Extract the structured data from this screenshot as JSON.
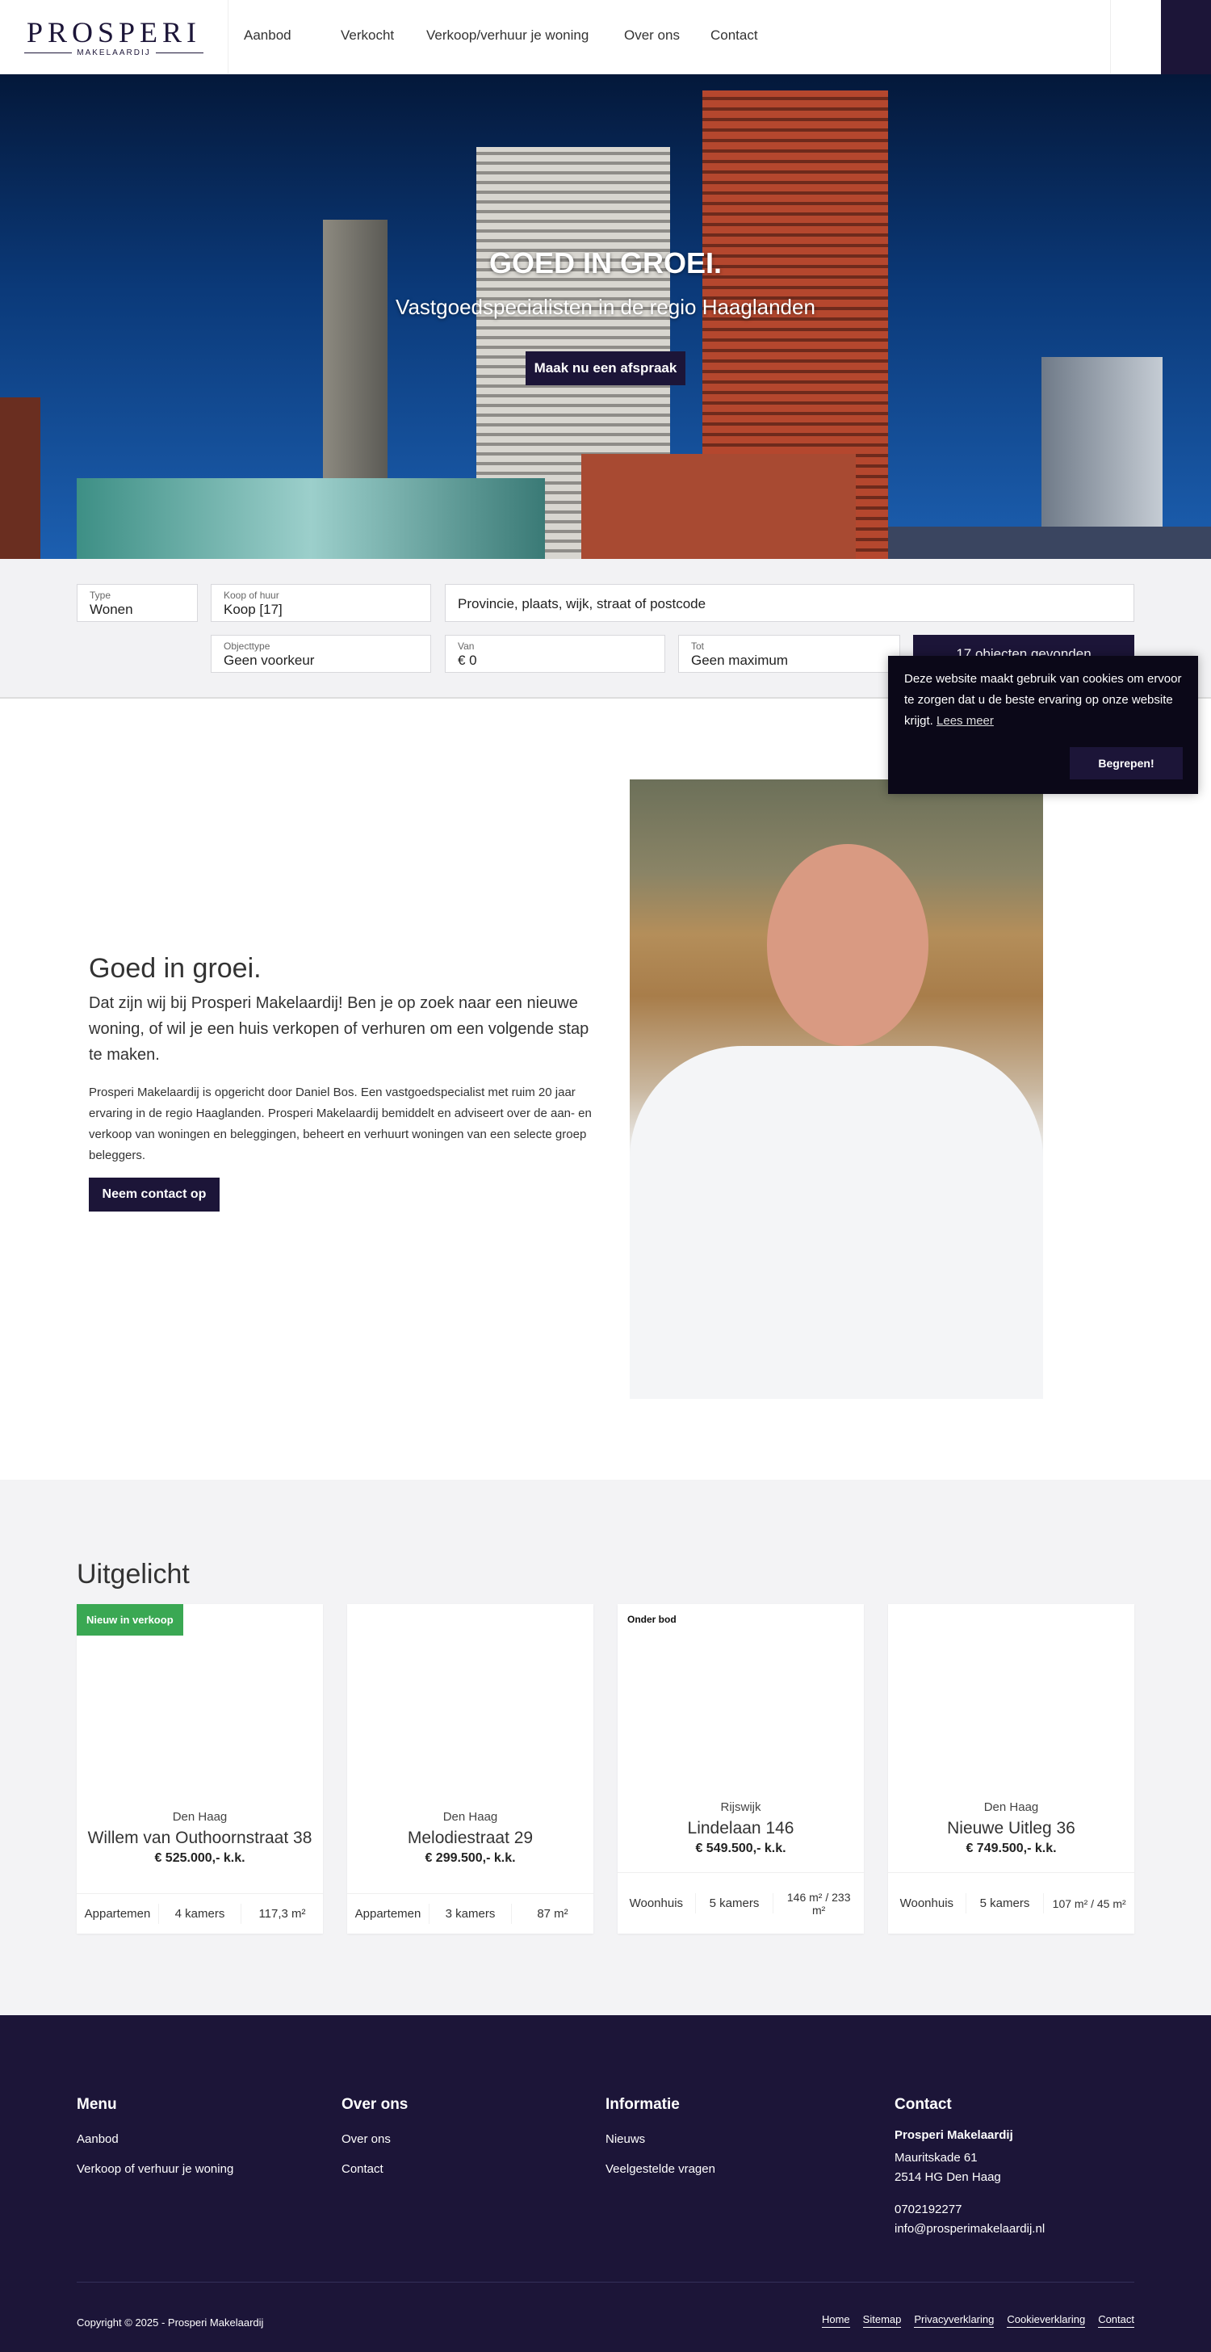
{
  "header": {
    "logo": {
      "name": "PROSPERI",
      "sub": "MAKELAARDIJ"
    },
    "nav": [
      "Aanbod",
      "Verkocht",
      "Verkoop/verhuur je woning",
      "Over ons",
      "Contact"
    ]
  },
  "hero": {
    "title": "GOED IN GROEI.",
    "subtitle": "Vastgoedspecialisten in de regio Haaglanden",
    "cta": "Maak nu een afspraak"
  },
  "search": {
    "type": {
      "label": "Type",
      "value": "Wonen"
    },
    "koop": {
      "label": "Koop of huur",
      "value": "Koop [17]"
    },
    "location_placeholder": "Provincie, plaats, wijk, straat of postcode",
    "objecttype": {
      "label": "Objecttype",
      "value": "Geen voorkeur"
    },
    "van": {
      "label": "Van",
      "value": "€ 0"
    },
    "tot": {
      "label": "Tot",
      "value": "Geen maximum"
    },
    "submit": "17 objecten gevonden"
  },
  "cookie": {
    "text": "Deze website maakt gebruik van cookies om ervoor te zorgen dat u de beste ervaring op onze website krijgt.",
    "link": "Lees meer",
    "button": "Begrepen!"
  },
  "about": {
    "heading": "Goed in groei.",
    "lead": "Dat zijn wij bij Prosperi Makelaardij! Ben je op zoek naar een nieuwe woning, of wil je een huis verkopen of verhuren om een volgende stap te maken.",
    "body": "Prosperi Makelaardij is opgericht door Daniel Bos. Een vastgoedspecialist met ruim 20 jaar ervaring in de regio Haaglanden. Prosperi Makelaardij bemiddelt en adviseert over de aan- en verkoop van woningen en beleggingen, beheert en verhuurt woningen van een selecte groep beleggers.",
    "cta": "Neem contact op"
  },
  "featured": {
    "heading": "Uitgelicht",
    "cards": [
      {
        "badge": "Nieuw in verkoop",
        "city": "Den Haag",
        "title": "Willem van Outhoornstraat 38",
        "price": "€ 525.000,- k.k.",
        "type": "Appartemen",
        "rooms": "4 kamers",
        "area": "117,3 m²"
      },
      {
        "badge": "",
        "city": "Den Haag",
        "title": "Melodiestraat 29",
        "price": "€ 299.500,- k.k.",
        "type": "Appartemen",
        "rooms": "3 kamers",
        "area": "87 m²"
      },
      {
        "badge": "Onder bod",
        "city": "Rijswijk",
        "title": "Lindelaan 146",
        "price": "€ 549.500,- k.k.",
        "type": "Woonhuis",
        "rooms": "5 kamers",
        "area": "146 m² / 233 m²"
      },
      {
        "badge": "",
        "city": "Den Haag",
        "title": "Nieuwe Uitleg 36",
        "price": "€ 749.500,- k.k.",
        "type": "Woonhuis",
        "rooms": "5 kamers",
        "area": "107 m² / 45 m²"
      }
    ]
  },
  "footer": {
    "menu": {
      "heading": "Menu",
      "links": [
        "Aanbod",
        "Verkoop of verhuur je woning"
      ]
    },
    "over": {
      "heading": "Over ons",
      "links": [
        "Over ons",
        "Contact"
      ]
    },
    "info": {
      "heading": "Informatie",
      "links": [
        "Nieuws",
        "Veelgestelde vragen"
      ]
    },
    "contact": {
      "heading": "Contact",
      "name": "Prosperi Makelaardij",
      "street": "Mauritskade 61",
      "city": "2514 HG Den Haag",
      "phone": "0702192277",
      "email": "info@prosperimakelaardij.nl"
    },
    "copyright": "Copyright © 2025 - Prosperi Makelaardij",
    "bottom_links": [
      "Home",
      "Sitemap",
      "Privacyverklaring",
      "Cookieverklaring",
      "Contact"
    ]
  },
  "colors": {
    "brand": "#1c1538",
    "badge_new": "#3aa853"
  }
}
